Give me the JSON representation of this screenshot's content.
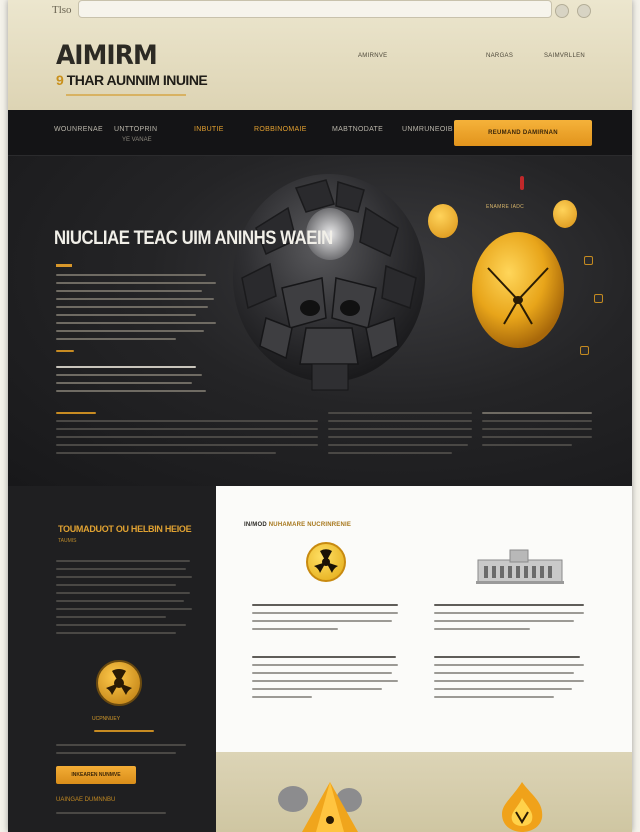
{
  "browser": {
    "title": "Tlso"
  },
  "brand": {
    "name": "AIMIRM",
    "tagline_a": "9",
    "tagline_b": "THAR AUNNIM INUINE"
  },
  "top_links": [
    "AMIRNVE",
    "NARGAS",
    "SAIMVRLLEN"
  ],
  "nav": {
    "items": [
      "WOUNRENAE",
      "UNTTOPRIN",
      "INBUTIE",
      "ROBBINOMAIE",
      "MABTNODATE",
      "UNMRUNEOIB"
    ],
    "sub": "YE VANAE",
    "cta": "REUMAND DAMIRNAN"
  },
  "hero": {
    "title": "NIUCLIAE TEAC UIM ANINHS WAEIN",
    "caption": "ENAMRE IADC"
  },
  "left": {
    "title": "TOUMADUOT OU HELBIN HEIOE",
    "sub": "TAUMIS",
    "caption": "UCPNNUEY",
    "button": "INKEAREN NUNMVE",
    "footer": "UAINGAE DUMNNBU"
  },
  "panel": {
    "title_a": "IN/MOD",
    "title_b": "NUHAMARE NUCRINRENIE"
  },
  "colors": {
    "accent": "#e2941c",
    "dark": "#1b1b1d",
    "cream": "#ddd4b4"
  }
}
